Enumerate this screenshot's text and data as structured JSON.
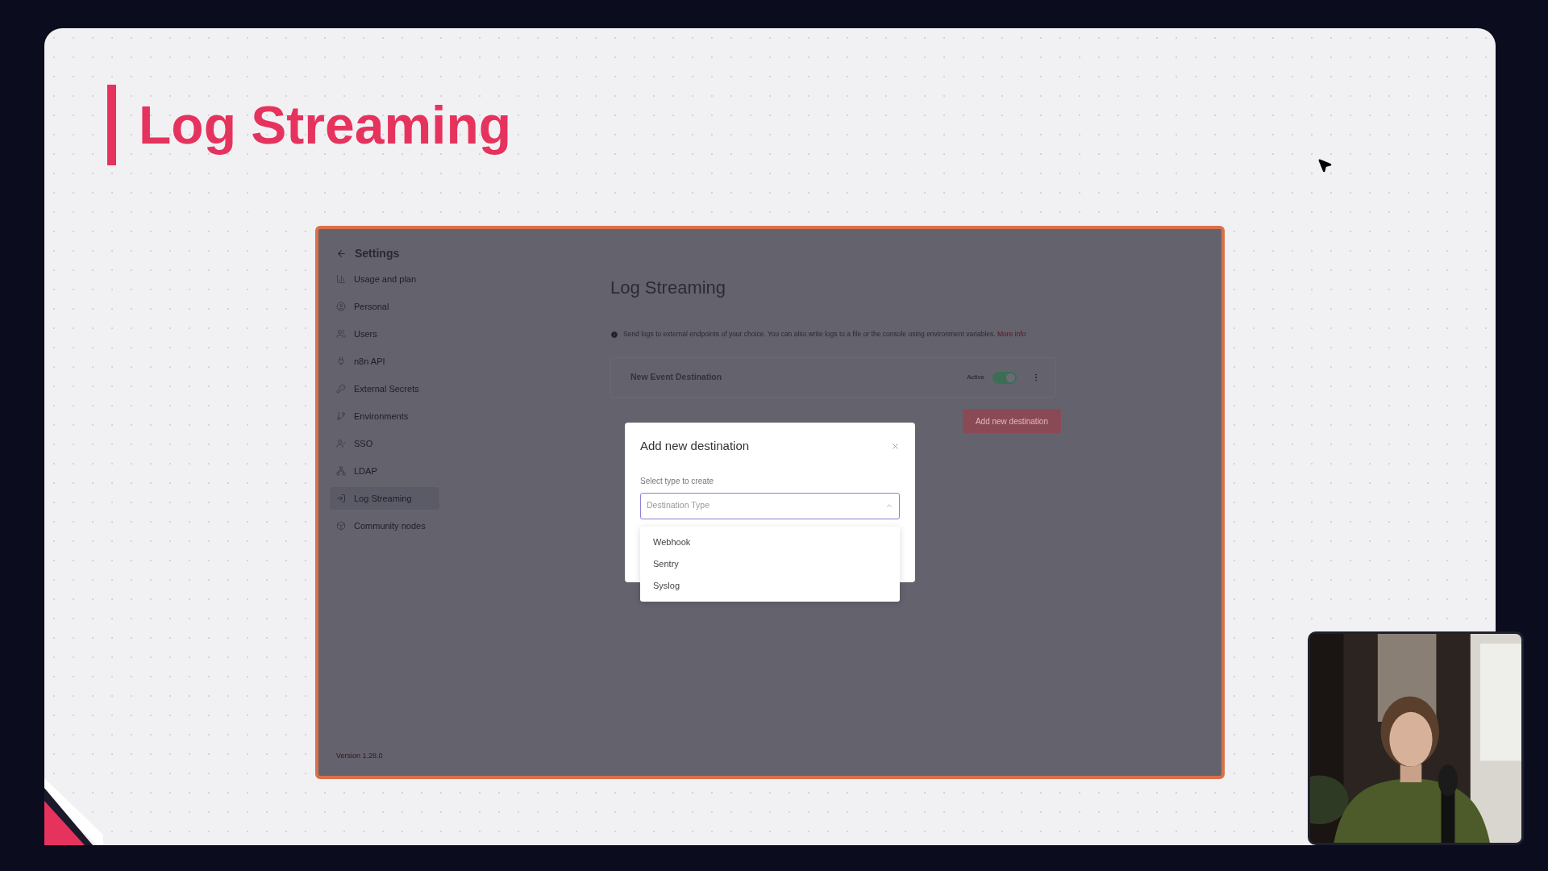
{
  "slide": {
    "title": "Log Streaming"
  },
  "app": {
    "sidebar": {
      "back_label": "Settings",
      "items": [
        {
          "label": "Usage and plan",
          "selected": false
        },
        {
          "label": "Personal",
          "selected": false
        },
        {
          "label": "Users",
          "selected": false
        },
        {
          "label": "n8n API",
          "selected": false
        },
        {
          "label": "External Secrets",
          "selected": false
        },
        {
          "label": "Environments",
          "selected": false
        },
        {
          "label": "SSO",
          "selected": false
        },
        {
          "label": "LDAP",
          "selected": false
        },
        {
          "label": "Log Streaming",
          "selected": true
        },
        {
          "label": "Community nodes",
          "selected": false
        }
      ],
      "version": "Version 1.28.0"
    },
    "main": {
      "title": "Log Streaming",
      "info_text": "Send logs to external endpoints of your choice. You can also write logs to a file or the console using environment variables.",
      "info_link": "More info",
      "destinations": [
        {
          "name": "New Event Destination",
          "status_label": "Active",
          "active": true
        }
      ],
      "add_button": "Add new destination"
    },
    "modal": {
      "title": "Add new destination",
      "field_label": "Select type to create",
      "select": {
        "placeholder": "Destination Type",
        "expanded": true
      },
      "options": [
        "Webhook",
        "Sentry",
        "Syslog"
      ]
    }
  }
}
